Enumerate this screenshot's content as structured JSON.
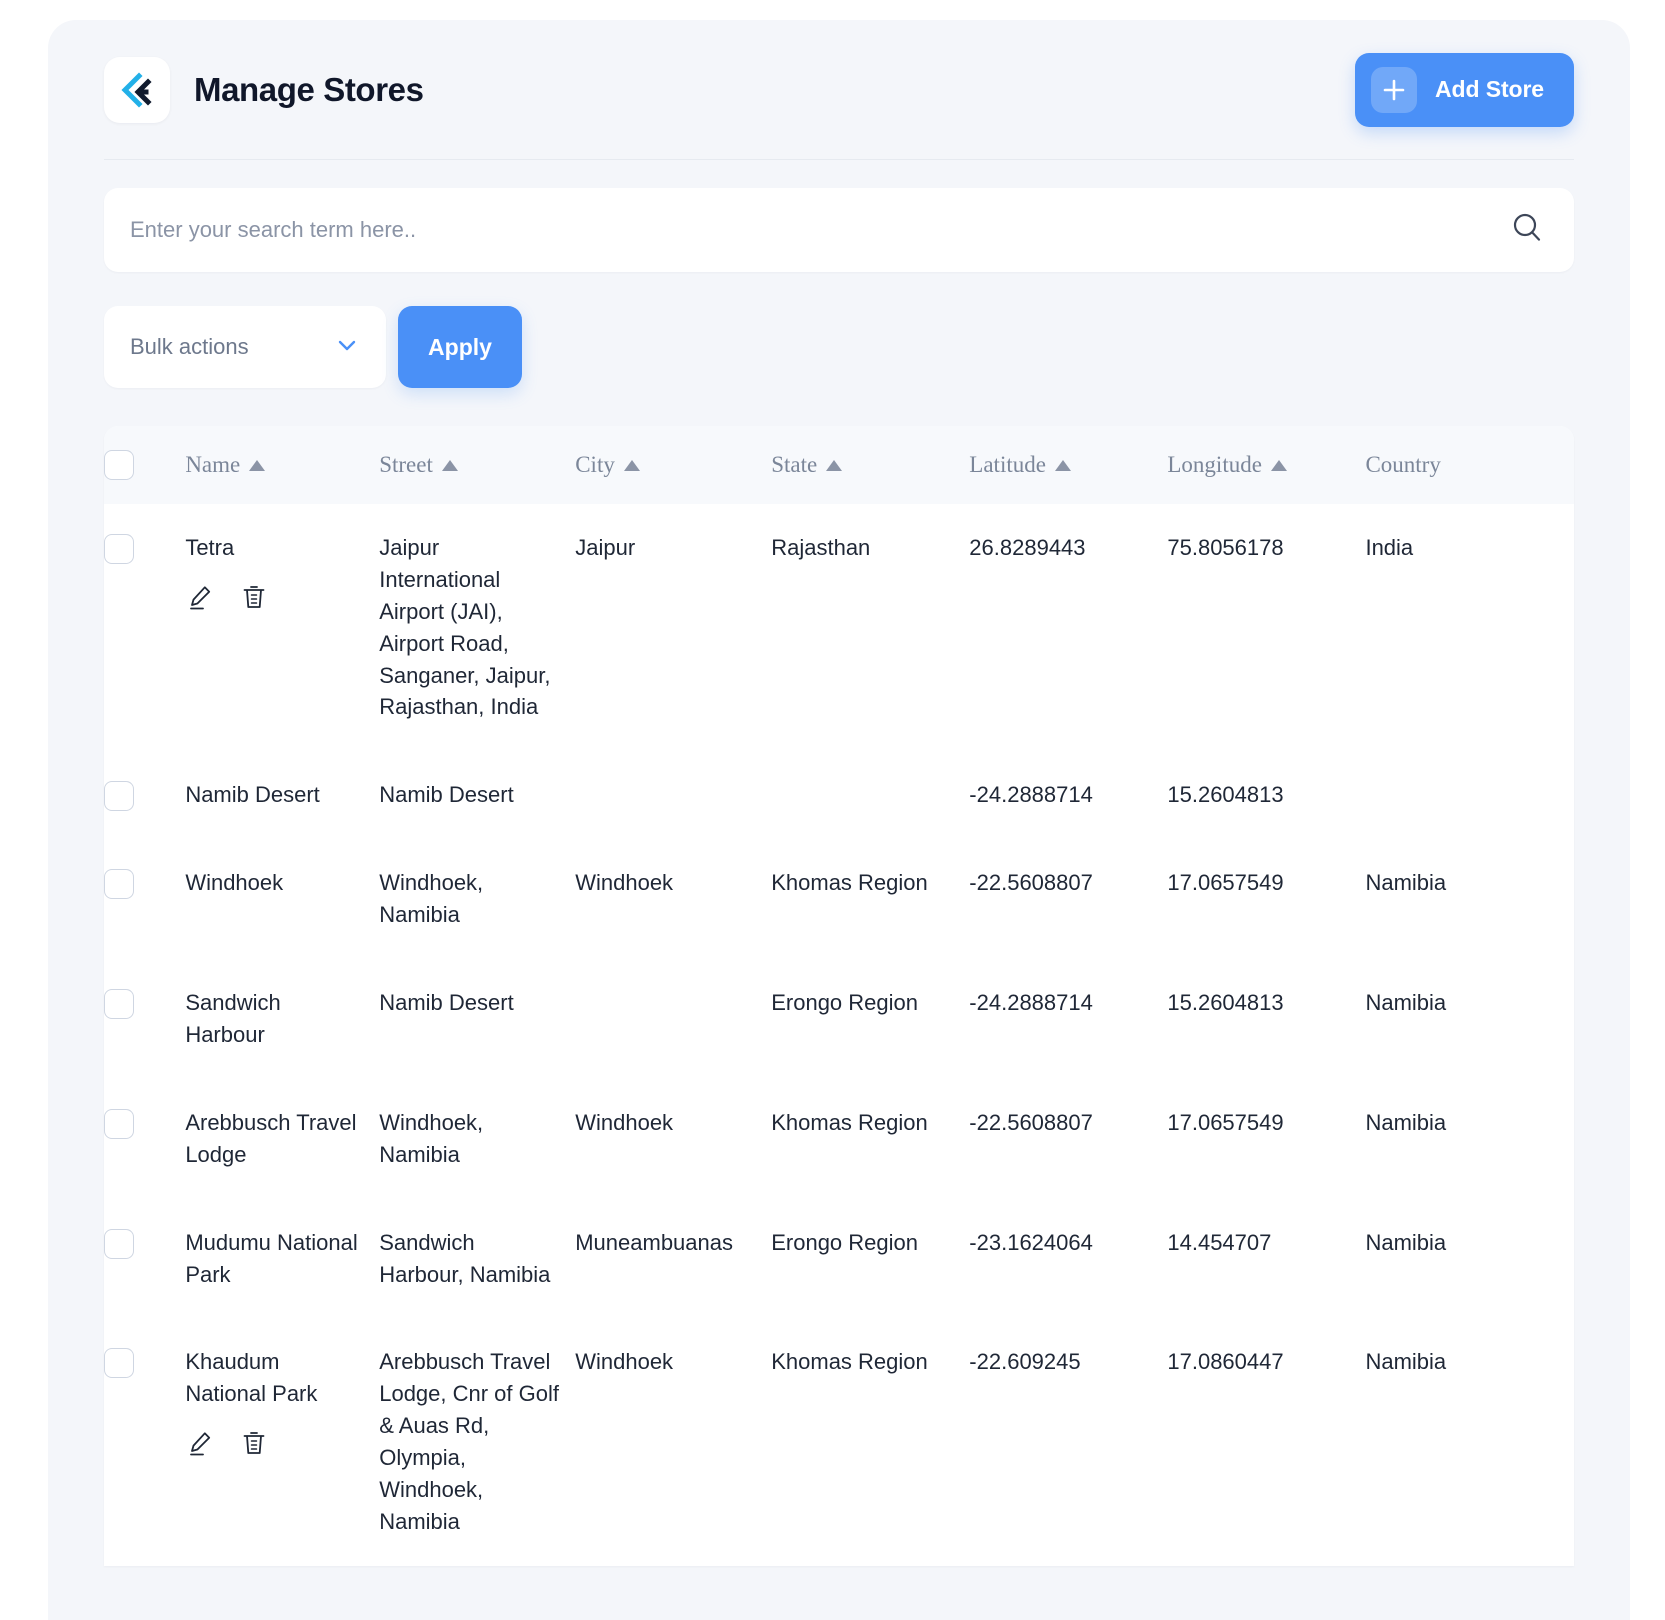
{
  "header": {
    "title": "Manage Stores",
    "logo_icon": "chevron-left-e-logo",
    "add_store_label": "Add Store",
    "add_store_icon": "plus-icon",
    "accent_color": "#4a90f7"
  },
  "search": {
    "placeholder": "Enter your search term here..",
    "value": "",
    "icon": "search-icon"
  },
  "bulk": {
    "select_label": "Bulk actions",
    "select_icon": "chevron-down-icon",
    "apply_label": "Apply"
  },
  "table": {
    "columns": [
      {
        "label": "Name",
        "sortable": true
      },
      {
        "label": "Street",
        "sortable": true
      },
      {
        "label": "City",
        "sortable": true
      },
      {
        "label": "State",
        "sortable": true
      },
      {
        "label": "Latitude",
        "sortable": true
      },
      {
        "label": "Longitude",
        "sortable": true
      },
      {
        "label": "Country",
        "sortable": false
      }
    ],
    "row_action_icons": [
      "edit-pencil-icon",
      "trash-icon"
    ],
    "rows": [
      {
        "name": "Tetra",
        "street": "Jaipur International Airport (JAI), Airport Road, Sanganer, Jaipur, Rajasthan, India",
        "city": "Jaipur",
        "state": "Rajasthan",
        "latitude": "26.8289443",
        "longitude": "75.8056178",
        "country": "India",
        "has_actions": true
      },
      {
        "name": "Namib Desert",
        "street": "Namib Desert",
        "city": "",
        "state": "",
        "latitude": "-24.2888714",
        "longitude": "15.2604813",
        "country": "",
        "has_actions": false
      },
      {
        "name": "Windhoek",
        "street": "Windhoek, Namibia",
        "city": "Windhoek",
        "state": "Khomas Region",
        "latitude": "-22.5608807",
        "longitude": "17.0657549",
        "country": "Namibia",
        "has_actions": false
      },
      {
        "name": "Sandwich Harbour",
        "street": "Namib Desert",
        "city": "",
        "state": "Erongo Region",
        "latitude": "-24.2888714",
        "longitude": "15.2604813",
        "country": "Namibia",
        "has_actions": false
      },
      {
        "name": "Arebbusch Travel Lodge",
        "street": "Windhoek, Namibia",
        "city": "Windhoek",
        "state": "Khomas Region",
        "latitude": "-22.5608807",
        "longitude": "17.0657549",
        "country": "Namibia",
        "has_actions": false
      },
      {
        "name": "Mudumu National Park",
        "street": "Sandwich Harbour, Namibia",
        "city": "Muneambuanas",
        "state": "Erongo Region",
        "latitude": "-23.1624064",
        "longitude": "14.454707",
        "country": "Namibia",
        "has_actions": false
      },
      {
        "name": "Khaudum National Park",
        "street": "Arebbusch Travel Lodge, Cnr of Golf & Auas Rd, Olympia, Windhoek, Namibia",
        "city": "Windhoek",
        "state": "Khomas Region",
        "latitude": "-22.609245",
        "longitude": "17.0860447",
        "country": "Namibia",
        "has_actions": true
      }
    ]
  }
}
